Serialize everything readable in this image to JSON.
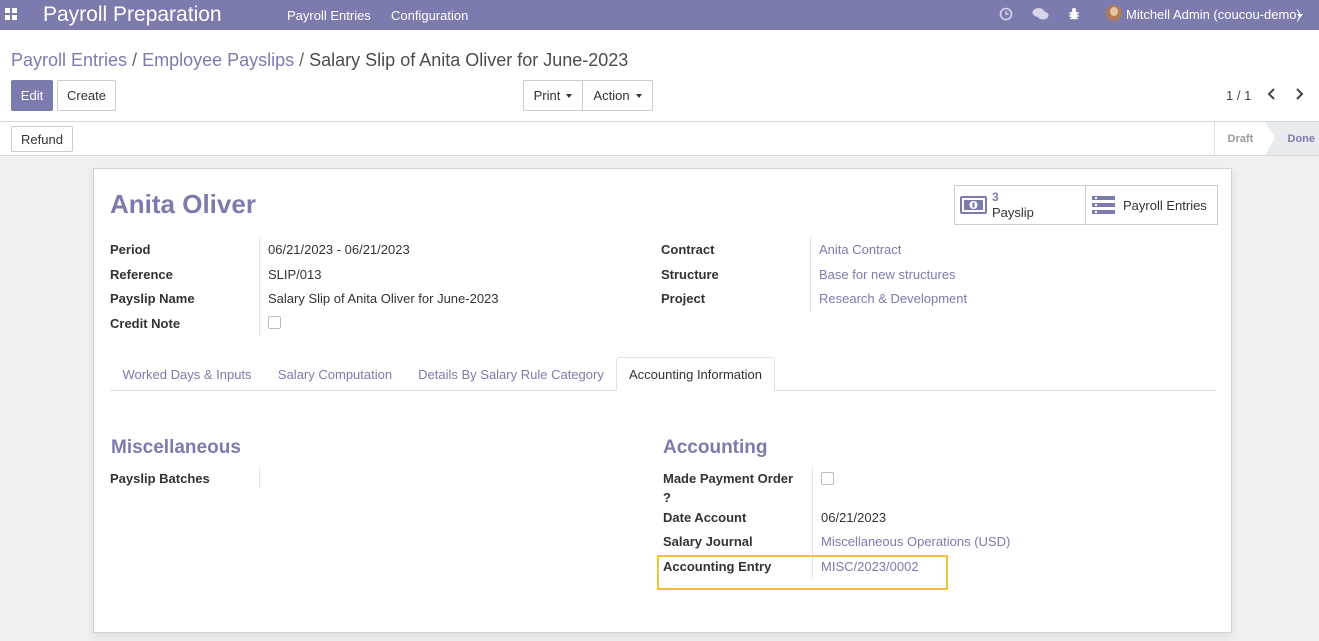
{
  "navbar": {
    "app_title": "Payroll Preparation",
    "menus": [
      "Payroll Entries",
      "Configuration"
    ],
    "user_name": "Mitchell Admin (coucou-demo)",
    "icons": [
      "apps-icon",
      "clock-icon",
      "chat-icon",
      "bug-icon"
    ]
  },
  "breadcrumb": {
    "items": [
      "Payroll Entries",
      "Employee Payslips"
    ],
    "separator": "/",
    "current": "Salary Slip of Anita Oliver for June-2023"
  },
  "toolbar": {
    "edit_label": "Edit",
    "create_label": "Create",
    "print_label": "Print",
    "action_label": "Action"
  },
  "pager": {
    "value": "1 / 1"
  },
  "statusbar": {
    "refund_label": "Refund",
    "stages": [
      "Draft",
      "Done"
    ],
    "active_stage": "Done"
  },
  "form": {
    "employee_name": "Anita Oliver",
    "smart_buttons": {
      "payslip_count": "3",
      "payslip_label": "Payslip",
      "entries_label": "Payroll Entries"
    },
    "left_fields": [
      {
        "label": "Period",
        "value": "06/21/2023 - 06/21/2023"
      },
      {
        "label": "Reference",
        "value": "SLIP/013"
      },
      {
        "label": "Payslip Name",
        "value": "Salary Slip of Anita Oliver for June-2023"
      },
      {
        "label": "Credit Note",
        "value": ""
      }
    ],
    "right_fields": [
      {
        "label": "Contract",
        "value": "Anita Contract"
      },
      {
        "label": "Structure",
        "value": "Base for new structures"
      },
      {
        "label": "Project",
        "value": "Research & Development"
      }
    ],
    "tabs": [
      "Worked Days & Inputs",
      "Salary Computation",
      "Details By Salary Rule Category",
      "Accounting Information"
    ],
    "active_tab": "Accounting Information",
    "miscellaneous": {
      "title": "Miscellaneous",
      "payslip_batches_label": "Payslip Batches",
      "payslip_batches_value": ""
    },
    "accounting": {
      "title": "Accounting",
      "made_payment_order_label_line1": "Made Payment Order",
      "made_payment_order_label_line2": "?",
      "date_account_label": "Date Account",
      "date_account_value": "06/21/2023",
      "salary_journal_label": "Salary Journal",
      "salary_journal_value": "Miscellaneous Operations (USD)",
      "accounting_entry_label": "Accounting Entry",
      "accounting_entry_value": "MISC/2023/0002"
    },
    "colors": {
      "accent": "#7c7bad",
      "highlight": "#f5c13b"
    }
  }
}
